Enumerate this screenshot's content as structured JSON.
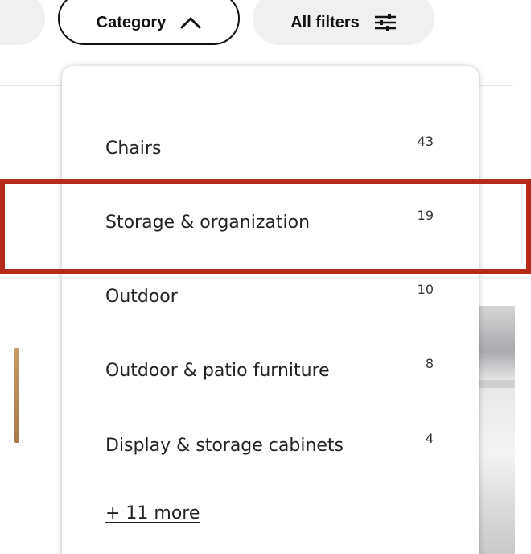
{
  "filters": {
    "category_label": "Category",
    "all_filters_label": "All filters"
  },
  "dropdown": {
    "options": [
      {
        "label": "Chairs",
        "count": "43"
      },
      {
        "label": "Storage & organization",
        "count": "19"
      },
      {
        "label": "Outdoor",
        "count": "10"
      },
      {
        "label": "Outdoor & patio furniture",
        "count": "8"
      },
      {
        "label": "Display & storage cabinets",
        "count": "4"
      }
    ],
    "more_label": "+ 11 more"
  },
  "highlight": {
    "color": "#b52a18",
    "target": "Storage & organization"
  },
  "icons": {
    "category_chevron": "chevron-up-icon",
    "filters": "sliders-icon"
  }
}
